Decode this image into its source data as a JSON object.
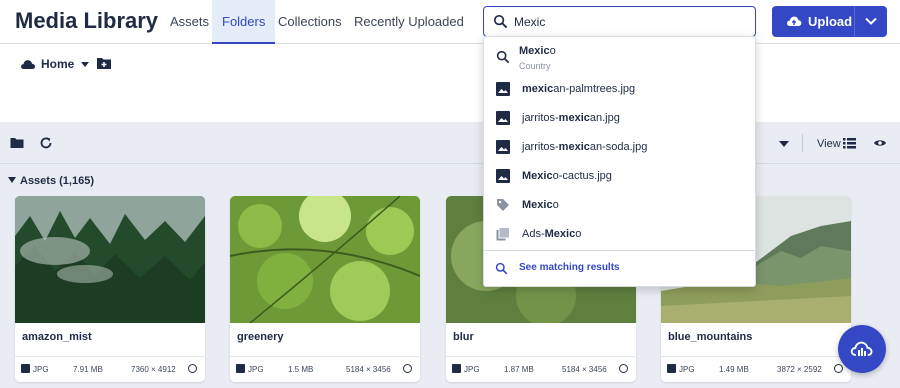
{
  "header": {
    "title": "Media Library",
    "tabs": [
      {
        "label": "Assets"
      },
      {
        "label": "Folders"
      },
      {
        "label": "Collections"
      },
      {
        "label": "Recently Uploaded"
      }
    ],
    "active_tab": "Folders",
    "search": {
      "value": "Mexic"
    },
    "upload_label": "Upload"
  },
  "breadcrumb": {
    "home_label": "Home"
  },
  "toolbar": {
    "view_label": "View"
  },
  "assets": {
    "header": "Assets (1,165)",
    "items": [
      {
        "name": "amazon_mist",
        "format": "JPG",
        "size": "7.91 MB",
        "dims": "7360 × 4912"
      },
      {
        "name": "greenery",
        "format": "JPG",
        "size": "1.5 MB",
        "dims": "5184 × 3456"
      },
      {
        "name": "blur",
        "format": "JPG",
        "size": "1.87 MB",
        "dims": "5184 × 3456"
      },
      {
        "name": "blue_mountains",
        "format": "JPG",
        "size": "1.49 MB",
        "dims": "3872 × 2592"
      }
    ]
  },
  "search_dropdown": {
    "query_match": "Mexic",
    "items": [
      {
        "type": "search",
        "bold": "Mexic",
        "rest_pre": "",
        "rest": "o",
        "sub": "Country"
      },
      {
        "type": "image",
        "bold": "mexic",
        "rest_pre": "",
        "rest": "an-palmtrees.jpg"
      },
      {
        "type": "image",
        "bold": "mexic",
        "rest_pre": "jarritos-",
        "rest": "an.jpg"
      },
      {
        "type": "image",
        "bold": "mexic",
        "rest_pre": "jarritos-",
        "rest": "an-soda.jpg"
      },
      {
        "type": "image",
        "bold": "Mexic",
        "rest_pre": "",
        "rest": "o-cactus.jpg"
      },
      {
        "type": "tag",
        "bold": "Mexic",
        "rest_pre": "",
        "rest": "o"
      },
      {
        "type": "collection",
        "bold": "Mexic",
        "rest_pre": "Ads-",
        "rest": "o"
      }
    ],
    "see_all": "See matching results"
  },
  "colors": {
    "accent": "#3448c5",
    "text": "#1f2a44",
    "content_bg": "#e9edf3"
  }
}
